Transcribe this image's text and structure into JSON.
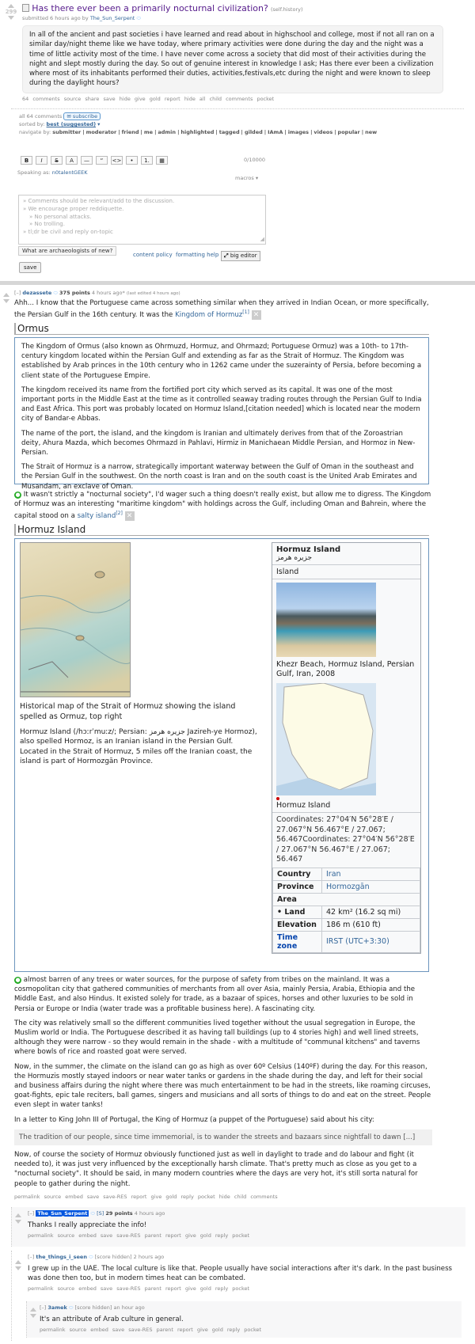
{
  "post": {
    "score": "299",
    "title": "Has there ever been a primarily nocturnal civilization?",
    "domain": "(self.history)",
    "submitted": "submitted 6 hours ago by",
    "author": "The_Sun_Serpent",
    "body": "In all of the ancient and past societies i have learned and read about in highschool and college, most if not all ran on a similar day/night theme like we have today, where primary activities were done during the day and the night was a time of little activity most of the time. I have never come across a society that did most of their activities during the night and slept mostly during the day. So out of genuine interest in knowledge I ask; Has there ever been a civilization where most of its inhabitants performed their duties, activities,festivals,etc during the night and were known to sleep during the daylight hours?",
    "links": [
      "64 comments",
      "source",
      "share",
      "save",
      "hide",
      "give gold",
      "report",
      "hide all child comments",
      "pocket"
    ]
  },
  "comments_area": {
    "all_comments": "all 64 comments",
    "subscribe": "subscribe",
    "sorted_by": "sorted by:",
    "sort_value": "best (suggested)",
    "navigate_by": "navigate by:",
    "nav": [
      "submitter",
      "moderator",
      "friend",
      "me",
      "admin",
      "highlighted",
      "tagged",
      "gilded",
      "IAmA",
      "images",
      "videos",
      "popular",
      "new"
    ]
  },
  "editor": {
    "toolbar": [
      "B",
      "I",
      "S",
      "A",
      "—",
      "“",
      "<>",
      "•",
      "1.",
      "▦"
    ],
    "count": "0/10000",
    "speaking_as": "Speaking as:",
    "user": "n0talentGEEK",
    "macros": "macros",
    "placeholder_lines": [
      "» Comments should be relevant/add to the discussion.",
      "» We encourage proper reddiquette.",
      "» No personal attacks.",
      "» No trolling.",
      "» tl;dr be civil and reply on-topic"
    ],
    "question": "What are archaeologists of new?",
    "content_policy": "content policy",
    "formatting_help": "formatting help",
    "big_editor": "big editor",
    "save": "save"
  },
  "c1": {
    "toggle": "[–]",
    "author": "dezassete",
    "points": "375 points",
    "time": "4 hours ago*",
    "edited": "(last edited 4 hours ago)",
    "intro": "Ahh... I know that the Portuguese came across something similar when they arrived in Indian Ocean, or more specifically, the Persian Gulf in the 16th century. It was the",
    "intro_link": "Kingdom of Hormuz",
    "ref1": "[1]",
    "wiki1_title": "Ormus",
    "wiki1_p": [
      "The Kingdom of Ormus (also known as Ohrmuzd, Hormuz, and Ohrmazd; Portuguese Ormuz) was a 10th- to 17th-century kingdom located within the Persian Gulf and extending as far as the Strait of Hormuz. The Kingdom was established by Arab princes in the 10th century who in 1262 came under the suzerainty of Persia, before becoming a client state of the Portuguese Empire.",
      "The kingdom received its name from the fortified port city which served as its capital. It was one of the most important ports in the Middle East at the time as it controlled seaway trading routes through the Persian Gulf to India and East Africa. This port was probably located on Hormuz Island,[citation needed] which is located near the modern city of Bandar-e Abbas.",
      "The name of the port, the island, and the kingdom is Iranian and ultimately derives from that of the Zoroastrian deity, Ahura Mazda, which becomes Ohrmazd in Pahlavi, Hirmiz in Manichaean Middle Persian, and Hormoz in New-Persian.",
      "The Strait of Hormuz is a narrow, strategically important waterway between the Gulf of Oman in the southeast and the Persian Gulf in the southwest. On the north coast is Iran and on the south coast is the United Arab Emirates and Musandam, an exclave of Oman."
    ],
    "mid": "It wasn't strictly a \"nocturnal society\", I'd wager such a thing doesn't really exist, but allow me to digress. The Kingdom of Hormuz was an interesting \"maritime kingdom\" with holdings across the Gulf, including Oman and Bahrein, where the capital stood on a",
    "mid_link": "salty island",
    "ref2": "[2]",
    "wiki2_title": "Hormuz Island",
    "map_caption": "Historical map of the Strait of Hormuz showing the island spelled as Ormuz, top right",
    "wiki2_text": "Hormuz Island (/hɔːrˈmuːz/; Persian: جزیره هرمز Jazireh-ye Hormoz), also spelled Hormoz, is an Iranian island in the Persian Gulf. Located in the Strait of Hormuz, 5 miles off the Iranian coast, the island is part of Hormozgān Province.",
    "infobox": {
      "title": "Hormuz Island",
      "subtitle": "جزیره هرمز",
      "type": "Island",
      "photo_caption": "Khezr Beach, Hormuz Island, Persian Gulf, Iran, 2008",
      "map_caption": "Hormuz Island",
      "coords": "Coordinates: 27°04′N 56°28′E / 27.067°N 56.467°E / 27.067; 56.467Coordinates: 27°04′N 56°28′E / 27.067°N 56.467°E / 27.067; 56.467",
      "rows": [
        {
          "k": "Country",
          "v": "Iran"
        },
        {
          "k": "Province",
          "v": "Hormozgān"
        },
        {
          "k": "Area",
          "v": ""
        },
        {
          "k": "• Land",
          "v": "42 km² (16.2 sq mi)"
        },
        {
          "k": "Elevation",
          "v": "186 m (610 ft)"
        },
        {
          "k": "Time zone",
          "v": "IRST (UTC+3:30)"
        }
      ]
    },
    "after": [
      "almost barren of any trees or water sources, for the purpose of safety from tribes on the mainland. It was a cosmopolitan city that gathered communities of merchants from all over Asia, mainly Persia, Arabia, Ethiopia and the Middle East, and also Hindus. It existed solely for trade, as a bazaar of spices, horses and other luxuries to be sold in Persia or Europe or India (water trade was a profitable business here). A fascinating city.",
      "The city was relatively small so the different communities lived together without the usual segregation in Europe, the Muslim world or India. The Portuguese described it as having tall buildings (up to 4 stories high) and well lined streets, although they were narrow - so they would remain in the shade - with a multitude of \"communal kitchens\" and taverns where bowls of rice and roasted goat were served.",
      "Now, in the summer, the climate on the island can go as high as over 60º Celsius (140ºF) during the day. For this reason, the Hormuzis mostly stayed indoors or near water tanks or gardens in the shade during the day, and left for their social and business affairs during the night where there was much entertainment to be had in the streets, like roaming circuses, goat-fights, epic tale reciters, ball games, singers and musicians and all sorts of things to do and eat on the street. People even slept in water tanks!",
      "In a letter to King John III of Portugal, the King of Hormuz (a puppet of the Portuguese) said about his city:"
    ],
    "quote": "The tradition of our people, since time immemorial, is to wander the streets and bazaars since nightfall to dawn [...]",
    "closing": "Now, of course the society of Hormuz obviously functioned just as well in daylight to trade and do labour and fight (it needed to), it was just very influenced by the exceptionally harsh climate. That's pretty much as close as you get to a \"nocturnal society\". It should be said, in many modern countries where the days are very hot, it's still sorta natural for people to gather during the night.",
    "links": [
      "permalink",
      "source",
      "embed",
      "save",
      "save-RES",
      "report",
      "give gold",
      "reply",
      "pocket",
      "hide child comments"
    ]
  },
  "c2": {
    "toggle": "[–]",
    "author": "The_Sun_Serpent",
    "flair": "[S]",
    "points": "29 points",
    "time": "4 hours ago",
    "text": "Thanks I really appreciate the info!",
    "links": [
      "permalink",
      "source",
      "embed",
      "save",
      "save-RES",
      "parent",
      "report",
      "give gold",
      "reply",
      "pocket"
    ]
  },
  "c3": {
    "toggle": "[–]",
    "author": "the_things_i_seen",
    "score": "[score hidden]",
    "time": "2 hours ago",
    "text": "I grew up in the UAE. The local culture is like that. People usually have social interactions after it's dark. In the past business was done then too, but in modern times heat can be combated.",
    "links": [
      "permalink",
      "source",
      "embed",
      "save",
      "save-RES",
      "parent",
      "report",
      "give gold",
      "reply",
      "pocket"
    ]
  },
  "c4": {
    "toggle": "[–]",
    "author": "3amek",
    "score": "[score hidden]",
    "time": "an hour ago",
    "text": "It's an attribute of Arab culture in general.",
    "links": [
      "permalink",
      "source",
      "embed",
      "save",
      "save-RES",
      "parent",
      "report",
      "give gold",
      "reply",
      "pocket"
    ]
  },
  "colors": {
    "link": "#336699",
    "op_bg": "#0055df",
    "wiki_border": "#6c95bd"
  }
}
